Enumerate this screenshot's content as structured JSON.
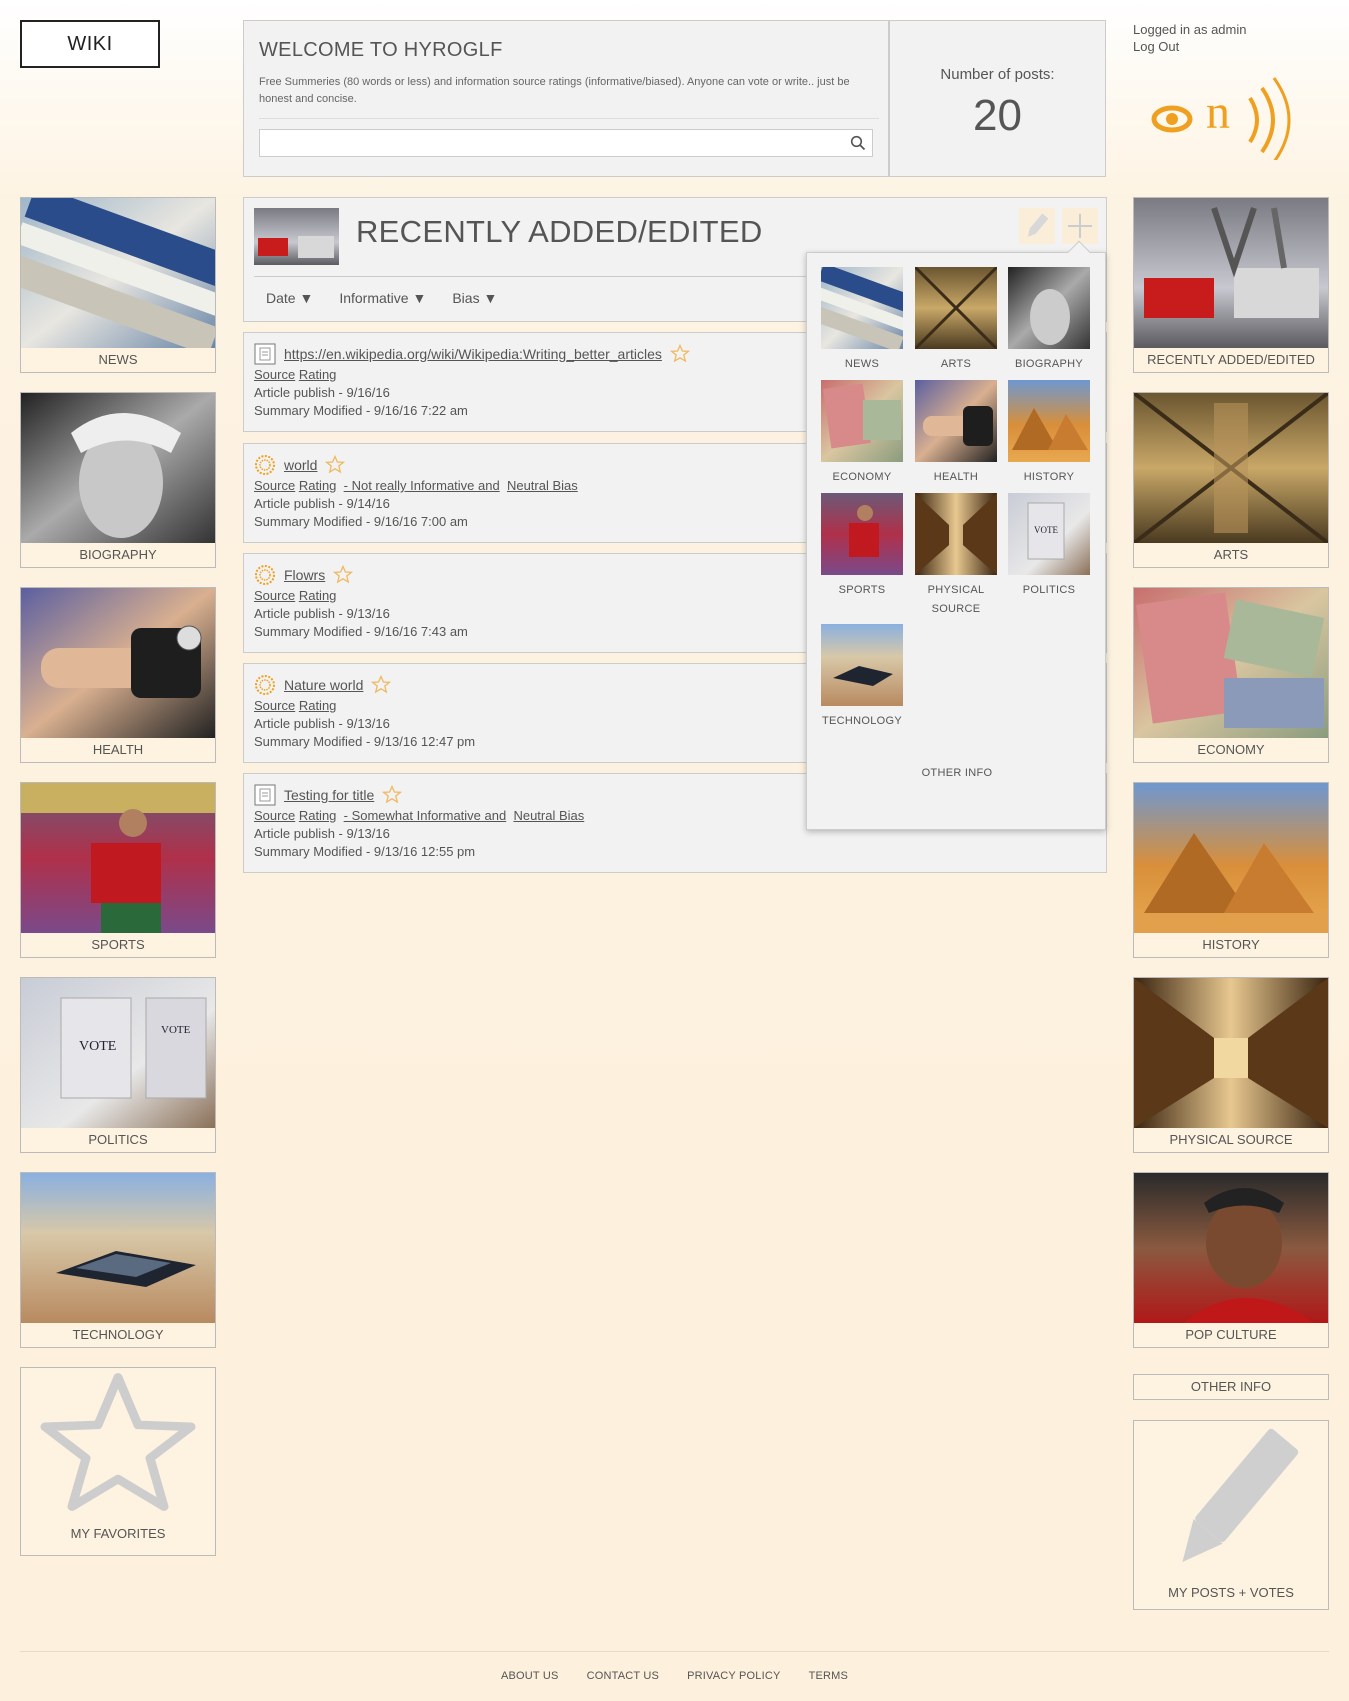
{
  "logo": {
    "label": "WIKI"
  },
  "welcome": {
    "title": "WELCOME TO HYROGLF",
    "description": "Free Summeries (80 words or less) and information source ratings (informative/biased). Anyone can vote or write.. just be honest and concise.",
    "search_placeholder": "",
    "search_value": ""
  },
  "stats": {
    "label": "Number of posts:",
    "value": "20"
  },
  "user": {
    "logged_in_text": "Logged in as admin",
    "logout_label": "Log Out"
  },
  "left_tiles": [
    {
      "label": "NEWS",
      "icon": "newspaper-image"
    },
    {
      "label": "BIOGRAPHY",
      "icon": "portrait-image"
    },
    {
      "label": "HEALTH",
      "icon": "blood-pressure-image"
    },
    {
      "label": "SPORTS",
      "icon": "soccer-player-image"
    },
    {
      "label": "POLITICS",
      "icon": "vote-booth-image"
    },
    {
      "label": "TECHNOLOGY",
      "icon": "solar-car-image"
    },
    {
      "label": "MY FAVORITES",
      "icon": "star-icon"
    }
  ],
  "right_tiles": [
    {
      "label": "RECENTLY ADDED/EDITED",
      "icon": "factory-robots-image"
    },
    {
      "label": "ARTS",
      "icon": "chapel-ceiling-image"
    },
    {
      "label": "ECONOMY",
      "icon": "money-image"
    },
    {
      "label": "HISTORY",
      "icon": "pyramids-image"
    },
    {
      "label": "PHYSICAL SOURCE",
      "icon": "library-image"
    },
    {
      "label": "POP CULTURE",
      "icon": "celebrity-image"
    },
    {
      "label": "OTHER INFO",
      "icon": ""
    },
    {
      "label": "MY POSTS + VOTES",
      "icon": "pencil-icon"
    }
  ],
  "main": {
    "title": "RECENTLY ADDED/EDITED",
    "sort": {
      "date": "Date ▼",
      "informative": "Informative ▼",
      "bias": "Bias ▼"
    }
  },
  "posts": [
    {
      "title": "https://en.wikipedia.org/wiki/Wikipedia:Writing_better_articles",
      "icon": "document-icon",
      "source": "Source",
      "rating": "Rating",
      "rating_detail": "",
      "bias": "",
      "published": "Article publish - 9/16/16",
      "modified": "Summary Modified - 9/16/16 7:22 am"
    },
    {
      "title": "world",
      "icon": "sun-icon",
      "source": "Source",
      "rating": "Rating",
      "rating_detail": "- Not really Informative and",
      "bias": "Neutral Bias",
      "published": "Article publish - 9/14/16",
      "modified": "Summary Modified - 9/16/16 7:00 am"
    },
    {
      "title": "Flowrs",
      "icon": "sun-icon",
      "source": "Source",
      "rating": "Rating",
      "rating_detail": "",
      "bias": "",
      "published": "Article publish - 9/13/16",
      "modified": "Summary Modified - 9/16/16 7:43 am"
    },
    {
      "title": "Nature world",
      "icon": "sun-icon",
      "source": "Source",
      "rating": "Rating",
      "rating_detail": "",
      "bias": "",
      "published": "Article publish - 9/13/16",
      "modified": "Summary Modified - 9/13/16 12:47 pm"
    },
    {
      "title": "Testing for title",
      "icon": "document-icon",
      "source": "Source",
      "rating": "Rating",
      "rating_detail": "- Somewhat Informative and",
      "bias": "Neutral Bias",
      "published": "Article publish - 9/13/16",
      "modified": "Summary Modified - 9/13/16 12:55 pm"
    }
  ],
  "dropdown": {
    "items": [
      {
        "label": "NEWS"
      },
      {
        "label": "ARTS"
      },
      {
        "label": "BIOGRAPHY"
      },
      {
        "label": "ECONOMY"
      },
      {
        "label": "HEALTH"
      },
      {
        "label": "HISTORY"
      },
      {
        "label": "SPORTS"
      },
      {
        "label_line1": "PHYSICAL",
        "label_line2": "SOURCE"
      },
      {
        "label": "POLITICS"
      },
      {
        "label": "TECHNOLOGY"
      }
    ],
    "other": "OTHER INFO"
  },
  "footer": {
    "about": "ABOUT US",
    "contact": "CONTACT US",
    "privacy": "PRIVACY POLICY",
    "terms": "TERMS"
  },
  "colors": {
    "accent": "#f0a020",
    "panel": "#f2f2f2",
    "page": "#fdf0dc"
  }
}
